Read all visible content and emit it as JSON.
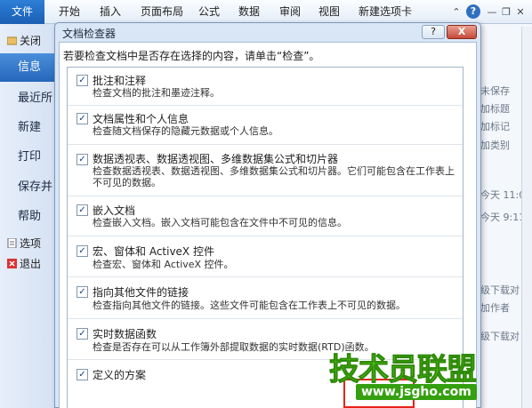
{
  "ribbon": {
    "file_tab": "文件",
    "tabs": [
      "开始",
      "插入",
      "页面布局",
      "公式",
      "数据",
      "审阅",
      "视图",
      "新建选项卡"
    ],
    "help": "?"
  },
  "nav": {
    "close_label": "关闭",
    "items": [
      {
        "label": "信息",
        "active": true
      },
      {
        "label": "最近所"
      },
      {
        "label": "新建"
      },
      {
        "label": "打印"
      },
      {
        "label": "保存并"
      },
      {
        "label": "帮助"
      }
    ],
    "options_label": "选项",
    "exit_label": "退出"
  },
  "background_right": {
    "lines": [
      "未保存",
      "加标题",
      "加标记",
      "加类别",
      "今天 11:0",
      "今天 9:11",
      "级下载对",
      "加作者",
      "级下载对"
    ]
  },
  "dialog": {
    "title": "文档检查器",
    "help": "?",
    "close": "X",
    "instruction": "若要检查文档中是否存在选择的内容，请单击“检查”。",
    "items": [
      {
        "title": "批注和注释",
        "desc": "检查文档的批注和墨迹注释。",
        "checked": true
      },
      {
        "title": "文档属性和个人信息",
        "desc": "检查随文档保存的隐藏元数据或个人信息。",
        "checked": true
      },
      {
        "title": "数据透视表、数据透视图、多维数据集公式和切片器",
        "desc": "检查数据透视表、数据透视图、多维数据集公式和切片器。它们可能包含在工作表上不可见的数据。",
        "checked": true
      },
      {
        "title": "嵌入文档",
        "desc": "检查嵌入文档。嵌入文档可能包含在文件中不可见的信息。",
        "checked": true
      },
      {
        "title": "宏、窗体和 ActiveX 控件",
        "desc": "检查宏、窗体和 ActiveX 控件。",
        "checked": true
      },
      {
        "title": "指向其他文件的链接",
        "desc": "检查指向其他文件的链接。这些文件可能包含在工作表上不可见的数据。",
        "checked": true
      },
      {
        "title": "实时数据函数",
        "desc": "检查是否存在可以从工作簿外部提取数据的实时数据(RTD)函数。",
        "checked": true
      },
      {
        "title": "定义的方案",
        "desc": "",
        "checked": true
      }
    ]
  },
  "watermark": {
    "brand": "技术员联盟",
    "url": "www.jsgho.com",
    "brand_color": "#5dd21a"
  }
}
